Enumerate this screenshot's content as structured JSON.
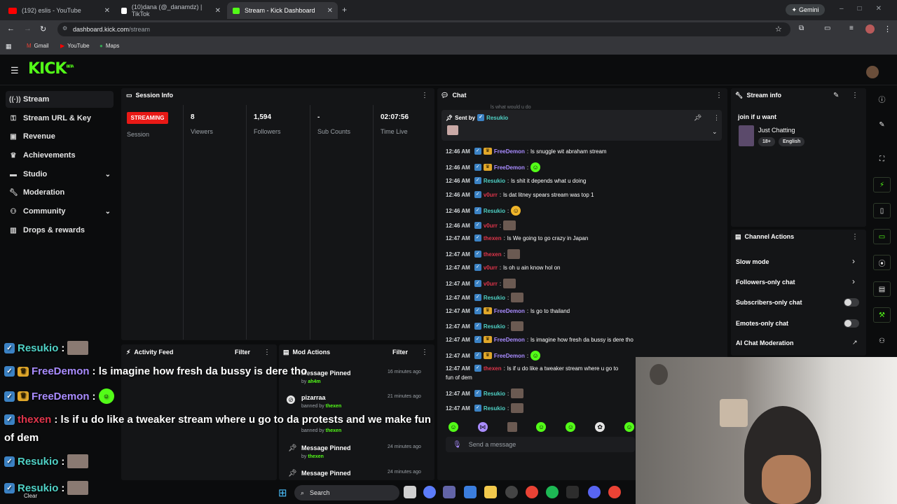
{
  "browser": {
    "tabs": [
      {
        "title": "(192) eslis - YouTube",
        "color": "#ff0000"
      },
      {
        "title": "(10)dana (@_danamdz) | TikTok",
        "color": "#ffffff"
      },
      {
        "title": "Stream - Kick Dashboard",
        "color": "#53fc18"
      }
    ],
    "gemini": "Gemini",
    "url_host": "dashboard.kick.com",
    "url_path": "/stream",
    "bookmarks": [
      "Gmail",
      "YouTube",
      "Maps"
    ]
  },
  "kick": {
    "logo": "KICK",
    "beta": "BETA"
  },
  "sidebar": {
    "items": [
      {
        "label": "Stream",
        "icon": "broadcast-icon"
      },
      {
        "label": "Stream URL & Key",
        "icon": "key-icon"
      },
      {
        "label": "Revenue",
        "icon": "revenue-icon"
      },
      {
        "label": "Achievements",
        "icon": "trophy-icon"
      },
      {
        "label": "Studio",
        "icon": "studio-icon"
      },
      {
        "label": "Moderation",
        "icon": "wrench-icon"
      },
      {
        "label": "Community",
        "icon": "people-icon"
      },
      {
        "label": "Drops & rewards",
        "icon": "drops-icon"
      }
    ]
  },
  "session": {
    "title": "Session Info",
    "status": "STREAMING",
    "status_sub": "Session",
    "stats": [
      {
        "value": "8",
        "label": "Viewers"
      },
      {
        "value": "1,594",
        "label": "Followers"
      },
      {
        "value": "-",
        "label": "Sub Counts"
      },
      {
        "value": "02:07:56",
        "label": "Time Live"
      }
    ]
  },
  "activity": {
    "title": "Activity Feed",
    "filter": "Filter"
  },
  "mod": {
    "title": "Mod Actions",
    "filter": "Filter",
    "items": [
      {
        "title": "Message Pinned",
        "sub_prefix": "by",
        "user": "ah4m",
        "time": "16 minutes ago"
      },
      {
        "title": "pizarraa",
        "sub_prefix": "banned by",
        "user": "thexen",
        "time": "21 minutes ago"
      },
      {
        "title": "",
        "sub_prefix": "banned by",
        "user": "thexen",
        "time": ""
      },
      {
        "title": "Message Pinned",
        "sub_prefix": "by",
        "user": "thexen",
        "time": "24 minutes ago"
      },
      {
        "title": "Message Pinned",
        "sub_prefix": "",
        "user": "",
        "time": "24 minutes ago"
      }
    ]
  },
  "chat": {
    "title": "Chat",
    "pinned_prefix": "Sent by",
    "pinned_user": "Resukio",
    "top_cut": "ls what would u do",
    "input_placeholder": "Send a message",
    "colors": {
      "FreeDemon": "#a98cff",
      "Resukio": "#4fd1c5",
      "v0urr": "#e0354b",
      "thexen": "#e0354b"
    },
    "messages": [
      {
        "time": "12:46 AM",
        "user": "FreeDemon",
        "crown": true,
        "text": "ls snuggle wit abraham stream",
        "media": ""
      },
      {
        "time": "12:46 AM",
        "user": "FreeDemon",
        "crown": true,
        "text": "",
        "media": "emote"
      },
      {
        "time": "12:46 AM",
        "user": "Resukio",
        "crown": false,
        "text": "ls shit it depends what u doing",
        "media": ""
      },
      {
        "time": "12:46 AM",
        "user": "v0urr",
        "crown": false,
        "text": "ls dat litney spears stream was top 1",
        "media": ""
      },
      {
        "time": "12:46 AM",
        "user": "Resukio",
        "crown": false,
        "text": "",
        "media": "emote-y"
      },
      {
        "time": "12:46 AM",
        "user": "v0urr",
        "crown": false,
        "text": "",
        "media": "img"
      },
      {
        "time": "12:47 AM",
        "user": "thexen",
        "crown": false,
        "text": "ls We going to go crazy in Japan",
        "media": ""
      },
      {
        "time": "12:47 AM",
        "user": "thexen",
        "crown": false,
        "text": "",
        "media": "img"
      },
      {
        "time": "12:47 AM",
        "user": "v0urr",
        "crown": false,
        "text": "ls oh u ain know hol on",
        "media": ""
      },
      {
        "time": "12:47 AM",
        "user": "v0urr",
        "crown": false,
        "text": "",
        "media": "img"
      },
      {
        "time": "12:47 AM",
        "user": "Resukio",
        "crown": false,
        "text": "",
        "media": "img"
      },
      {
        "time": "12:47 AM",
        "user": "FreeDemon",
        "crown": true,
        "text": "ls go to thailand",
        "media": ""
      },
      {
        "time": "12:47 AM",
        "user": "Resukio",
        "crown": false,
        "text": "",
        "media": "img"
      },
      {
        "time": "12:47 AM",
        "user": "FreeDemon",
        "crown": true,
        "text": "ls imagine how fresh da bussy is dere tho",
        "media": ""
      },
      {
        "time": "12:47 AM",
        "user": "FreeDemon",
        "crown": true,
        "text": "",
        "media": "emote"
      },
      {
        "time": "12:47 AM",
        "user": "thexen",
        "crown": false,
        "text": "ls if u do like a tweaker stream where u go to",
        "media": ""
      },
      {
        "time": "12:47 AM",
        "user": "Resukio",
        "crown": false,
        "text": "",
        "media": "img"
      },
      {
        "time": "12:47 AM",
        "user": "Resukio",
        "crown": false,
        "text": "",
        "media": "img"
      }
    ],
    "wrap_text": "fun of dem"
  },
  "streaminfo": {
    "title": "Stream info",
    "stream_title": "join if u want",
    "category": "Just Chatting",
    "tags": [
      "18+",
      "English"
    ]
  },
  "channel_actions": {
    "title": "Channel Actions",
    "items": [
      {
        "label": "Slow mode",
        "control": "chevron"
      },
      {
        "label": "Followers-only chat",
        "control": "chevron"
      },
      {
        "label": "Subscribers-only chat",
        "control": "toggle"
      },
      {
        "label": "Emotes-only chat",
        "control": "toggle"
      },
      {
        "label": "AI Chat Moderation",
        "control": "link"
      }
    ]
  },
  "overlay": {
    "lines": [
      {
        "user": "Resukio",
        "text": "",
        "crown": false
      },
      {
        "user": "FreeDemon",
        "text": ": ls imagine how fresh da bussy is dere tho",
        "crown": true
      },
      {
        "user": "FreeDemon",
        "text": "",
        "crown": true
      },
      {
        "user": "thexen",
        "text": ": ls if u do like a tweaker stream where u go to da protests and we make fun",
        "crown": false
      },
      {
        "user": "Resukio",
        "text": "",
        "crown": false
      },
      {
        "user": "Resukio",
        "text": "",
        "crown": false
      }
    ],
    "wrap": "of dem",
    "clear": "Clear"
  },
  "taskbar": {
    "search": "Search"
  }
}
